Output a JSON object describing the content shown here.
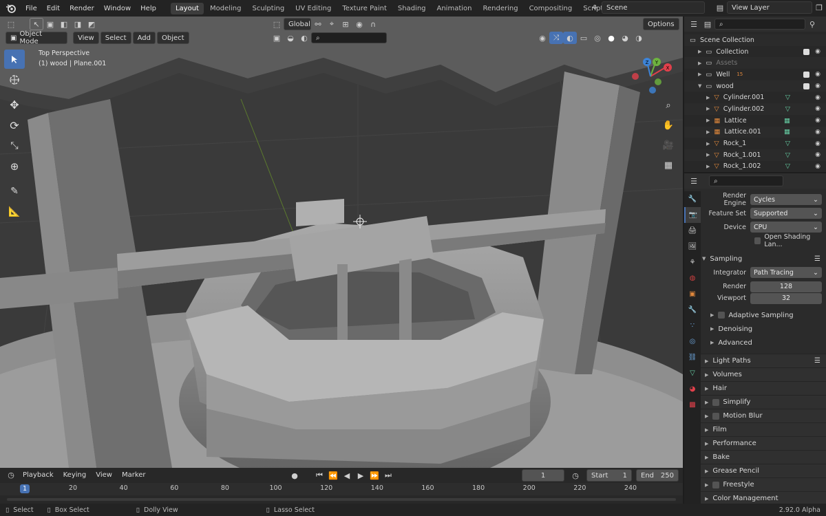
{
  "topbar": {
    "menus": [
      "File",
      "Edit",
      "Render",
      "Window",
      "Help"
    ],
    "workspaces": [
      "Layout",
      "Modeling",
      "Sculpting",
      "UV Editing",
      "Texture Paint",
      "Shading",
      "Animation",
      "Rendering",
      "Compositing",
      "Scripting"
    ],
    "active_workspace": "Layout",
    "add_tab_label": "+",
    "scene_name": "Scene",
    "view_layer_name": "View Layer"
  },
  "viewport": {
    "mode": "Object Mode",
    "menus": [
      "View",
      "Select",
      "Add",
      "Object"
    ],
    "transform_orientation": "Global",
    "options_label": "Options",
    "view_name": "Top Perspective",
    "active_object_info": "(1) wood | Plane.001",
    "gizmo_axes": [
      "X",
      "Y",
      "Z"
    ]
  },
  "outliner": {
    "search_placeholder": "",
    "rows": [
      {
        "name": "Scene Collection",
        "indent": 0,
        "icon": "scene-collection-icon"
      },
      {
        "name": "Collection",
        "indent": 1,
        "icon": "collection-icon"
      },
      {
        "name": "Assets",
        "indent": 1,
        "icon": "collection-icon",
        "dim": true
      },
      {
        "name": "Well",
        "indent": 1,
        "icon": "collection-icon",
        "badge": "15"
      },
      {
        "name": "wood",
        "indent": 1,
        "icon": "collection-icon"
      },
      {
        "name": "Cylinder.001",
        "indent": 2,
        "icon": "mesh-icon"
      },
      {
        "name": "Cylinder.002",
        "indent": 2,
        "icon": "mesh-icon"
      },
      {
        "name": "Lattice",
        "indent": 2,
        "icon": "lattice-icon"
      },
      {
        "name": "Lattice.001",
        "indent": 2,
        "icon": "lattice-icon"
      },
      {
        "name": "Rock_1",
        "indent": 2,
        "icon": "mesh-icon"
      },
      {
        "name": "Rock_1.001",
        "indent": 2,
        "icon": "mesh-icon"
      },
      {
        "name": "Rock_1.002",
        "indent": 2,
        "icon": "mesh-icon"
      }
    ]
  },
  "properties": {
    "render_engine_label": "Render Engine",
    "render_engine": "Cycles",
    "feature_set_label": "Feature Set",
    "feature_set": "Supported",
    "device_label": "Device",
    "device": "CPU",
    "open_shading_language": "Open Shading Lan...",
    "sampling_title": "Sampling",
    "integrator_label": "Integrator",
    "integrator": "Path Tracing",
    "render_label": "Render",
    "render_samples": "128",
    "viewport_label": "Viewport",
    "viewport_samples": "32",
    "sub_panels": [
      "Adaptive Sampling",
      "Denoising",
      "Advanced"
    ],
    "panels": [
      "Light Paths",
      "Volumes",
      "Hair",
      "Simplify",
      "Motion Blur",
      "Film",
      "Performance",
      "Bake",
      "Grease Pencil",
      "Freestyle",
      "Color Management"
    ]
  },
  "timeline": {
    "menus": [
      "Playback",
      "Keying",
      "View",
      "Marker"
    ],
    "current_frame": "1",
    "start_label": "Start",
    "start_frame": "1",
    "end_label": "End",
    "end_frame": "250",
    "ruler_marks": [
      "1",
      "20",
      "40",
      "60",
      "80",
      "100",
      "120",
      "140",
      "160",
      "180",
      "200",
      "220",
      "240"
    ]
  },
  "statusbar": {
    "hints": [
      "Select",
      "Box Select",
      "Dolly View",
      "Lasso Select"
    ],
    "version": "2.92.0 Alpha"
  },
  "colors": {
    "accent": "#4772b3",
    "axis_x": "#e0404b",
    "axis_y": "#6db33f",
    "axis_z": "#3d84d8",
    "mesh_orange": "#e0883c",
    "lattice_green": "#64c9a0"
  }
}
